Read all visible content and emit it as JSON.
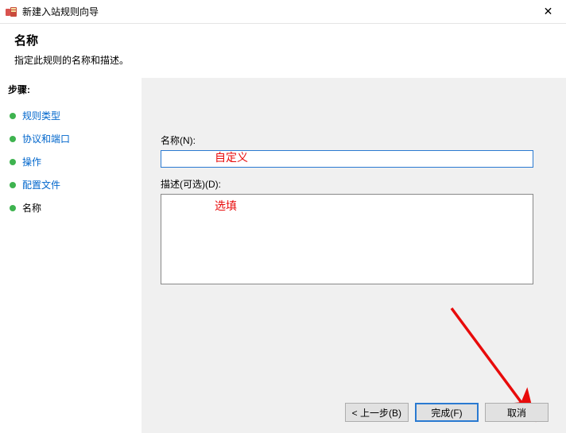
{
  "window": {
    "title": "新建入站规则向导",
    "close_glyph": "✕"
  },
  "header": {
    "title": "名称",
    "subtitle": "指定此规则的名称和描述。"
  },
  "sidebar": {
    "heading": "步骤:",
    "items": [
      {
        "label": "规则类型"
      },
      {
        "label": "协议和端口"
      },
      {
        "label": "操作"
      },
      {
        "label": "配置文件"
      },
      {
        "label": "名称"
      }
    ]
  },
  "form": {
    "name_label": "名称(N):",
    "name_value": "",
    "desc_label": "描述(可选)(D):",
    "desc_value": ""
  },
  "annotations": {
    "name_hint": "自定义",
    "desc_hint": "选填"
  },
  "buttons": {
    "back": "< 上一步(B)",
    "finish": "完成(F)",
    "cancel": "取消"
  }
}
